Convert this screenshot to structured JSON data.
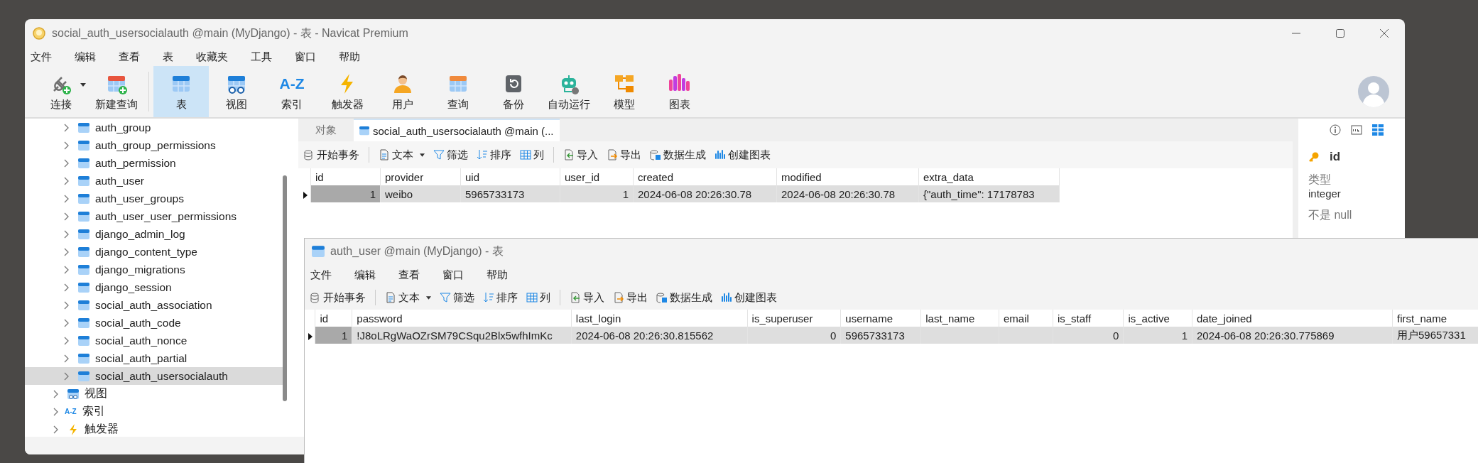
{
  "main_window": {
    "title": "social_auth_usersocialauth @main (MyDjango) - 表 - Navicat Premium",
    "menu": [
      "文件",
      "编辑",
      "查看",
      "表",
      "收藏夹",
      "工具",
      "窗口",
      "帮助"
    ],
    "toolbar": [
      {
        "label": "连接",
        "kind": "connect",
        "selected": false,
        "dropdown": true
      },
      {
        "label": "新建查询",
        "kind": "new-query",
        "selected": false
      },
      {
        "label": "表",
        "kind": "table",
        "selected": true
      },
      {
        "label": "视图",
        "kind": "view",
        "selected": false
      },
      {
        "label": "索引",
        "kind": "index",
        "glyph": "A-Z",
        "selected": false
      },
      {
        "label": "触发器",
        "kind": "trigger",
        "selected": false
      },
      {
        "label": "用户",
        "kind": "user",
        "selected": false
      },
      {
        "label": "查询",
        "kind": "query",
        "selected": false
      },
      {
        "label": "备份",
        "kind": "backup",
        "selected": false
      },
      {
        "label": "自动运行",
        "kind": "automation",
        "selected": false
      },
      {
        "label": "模型",
        "kind": "model",
        "selected": false
      },
      {
        "label": "图表",
        "kind": "chart",
        "selected": false
      }
    ],
    "tree": {
      "tables": [
        {
          "label": "auth_group",
          "selected": false
        },
        {
          "label": "auth_group_permissions",
          "selected": false
        },
        {
          "label": "auth_permission",
          "selected": false
        },
        {
          "label": "auth_user",
          "selected": false
        },
        {
          "label": "auth_user_groups",
          "selected": false
        },
        {
          "label": "auth_user_user_permissions",
          "selected": false
        },
        {
          "label": "django_admin_log",
          "selected": false
        },
        {
          "label": "django_content_type",
          "selected": false
        },
        {
          "label": "django_migrations",
          "selected": false
        },
        {
          "label": "django_session",
          "selected": false
        },
        {
          "label": "social_auth_association",
          "selected": false
        },
        {
          "label": "social_auth_code",
          "selected": false
        },
        {
          "label": "social_auth_nonce",
          "selected": false
        },
        {
          "label": "social_auth_partial",
          "selected": false
        },
        {
          "label": "social_auth_usersocialauth",
          "selected": true
        }
      ],
      "groups": [
        {
          "label": "视图",
          "kind": "view"
        },
        {
          "label": "索引",
          "kind": "index",
          "glyph": "A-Z"
        },
        {
          "label": "触发器",
          "kind": "trigger"
        }
      ]
    },
    "tabs": [
      {
        "label": "对象",
        "selected": false
      },
      {
        "label": "social_auth_usersocialauth @main (...",
        "selected": true
      }
    ],
    "data_toolbar": [
      {
        "label": "开始事务",
        "kind": "transaction"
      },
      {
        "label": "文本",
        "kind": "text",
        "dropdown": true
      },
      {
        "label": "筛选",
        "kind": "filter"
      },
      {
        "label": "排序",
        "kind": "sort"
      },
      {
        "label": "列",
        "kind": "columns"
      },
      {
        "label": "导入",
        "kind": "import"
      },
      {
        "label": "导出",
        "kind": "export"
      },
      {
        "label": "数据生成",
        "kind": "generate"
      },
      {
        "label": "创建图表",
        "kind": "chart"
      }
    ],
    "table": {
      "columns": [
        {
          "label": "id",
          "numeric": true
        },
        {
          "label": "provider",
          "numeric": false
        },
        {
          "label": "uid",
          "numeric": false
        },
        {
          "label": "user_id",
          "numeric": true
        },
        {
          "label": "created",
          "numeric": false
        },
        {
          "label": "modified",
          "numeric": false
        },
        {
          "label": "extra_data",
          "numeric": false
        }
      ],
      "rows": [
        {
          "selected": true,
          "cells": [
            "1",
            "weibo",
            "5965733173",
            "1",
            "2024-06-08 20:26:30.78",
            "2024-06-08 20:26:30.78",
            "{\"auth_time\": 17178783"
          ]
        }
      ]
    },
    "details": {
      "field": "id",
      "type_label": "类型",
      "type": "integer",
      "null_label": "不是 null"
    }
  },
  "second_window": {
    "title": "auth_user @main (MyDjango) - 表",
    "menu": [
      "文件",
      "编辑",
      "查看",
      "窗口",
      "帮助"
    ],
    "data_toolbar": [
      {
        "label": "开始事务",
        "kind": "transaction"
      },
      {
        "label": "文本",
        "kind": "text",
        "dropdown": true
      },
      {
        "label": "筛选",
        "kind": "filter"
      },
      {
        "label": "排序",
        "kind": "sort"
      },
      {
        "label": "列",
        "kind": "columns"
      },
      {
        "label": "导入",
        "kind": "import"
      },
      {
        "label": "导出",
        "kind": "export"
      },
      {
        "label": "数据生成",
        "kind": "generate"
      },
      {
        "label": "创建图表",
        "kind": "chart"
      }
    ],
    "table": {
      "columns": [
        {
          "label": "id",
          "numeric": true
        },
        {
          "label": "password",
          "numeric": false
        },
        {
          "label": "last_login",
          "numeric": false
        },
        {
          "label": "is_superuser",
          "numeric": true
        },
        {
          "label": "username",
          "numeric": false
        },
        {
          "label": "last_name"
        },
        {
          "label": "email"
        },
        {
          "label": "is_staff",
          "numeric": true
        },
        {
          "label": "is_active",
          "numeric": true
        },
        {
          "label": "date_joined",
          "numeric": false
        },
        {
          "label": "first_name",
          "numeric": false
        }
      ],
      "rows": [
        {
          "selected": true,
          "cells": [
            "1",
            "!J8oLRgWaOZrSM79CSqu2Blx5wfhImKc",
            "2024-06-08 20:26:30.815562",
            "0",
            "5965733173",
            "",
            "",
            "0",
            "1",
            "2024-06-08 20:26:30.775869",
            "用户59657331"
          ]
        }
      ]
    }
  }
}
